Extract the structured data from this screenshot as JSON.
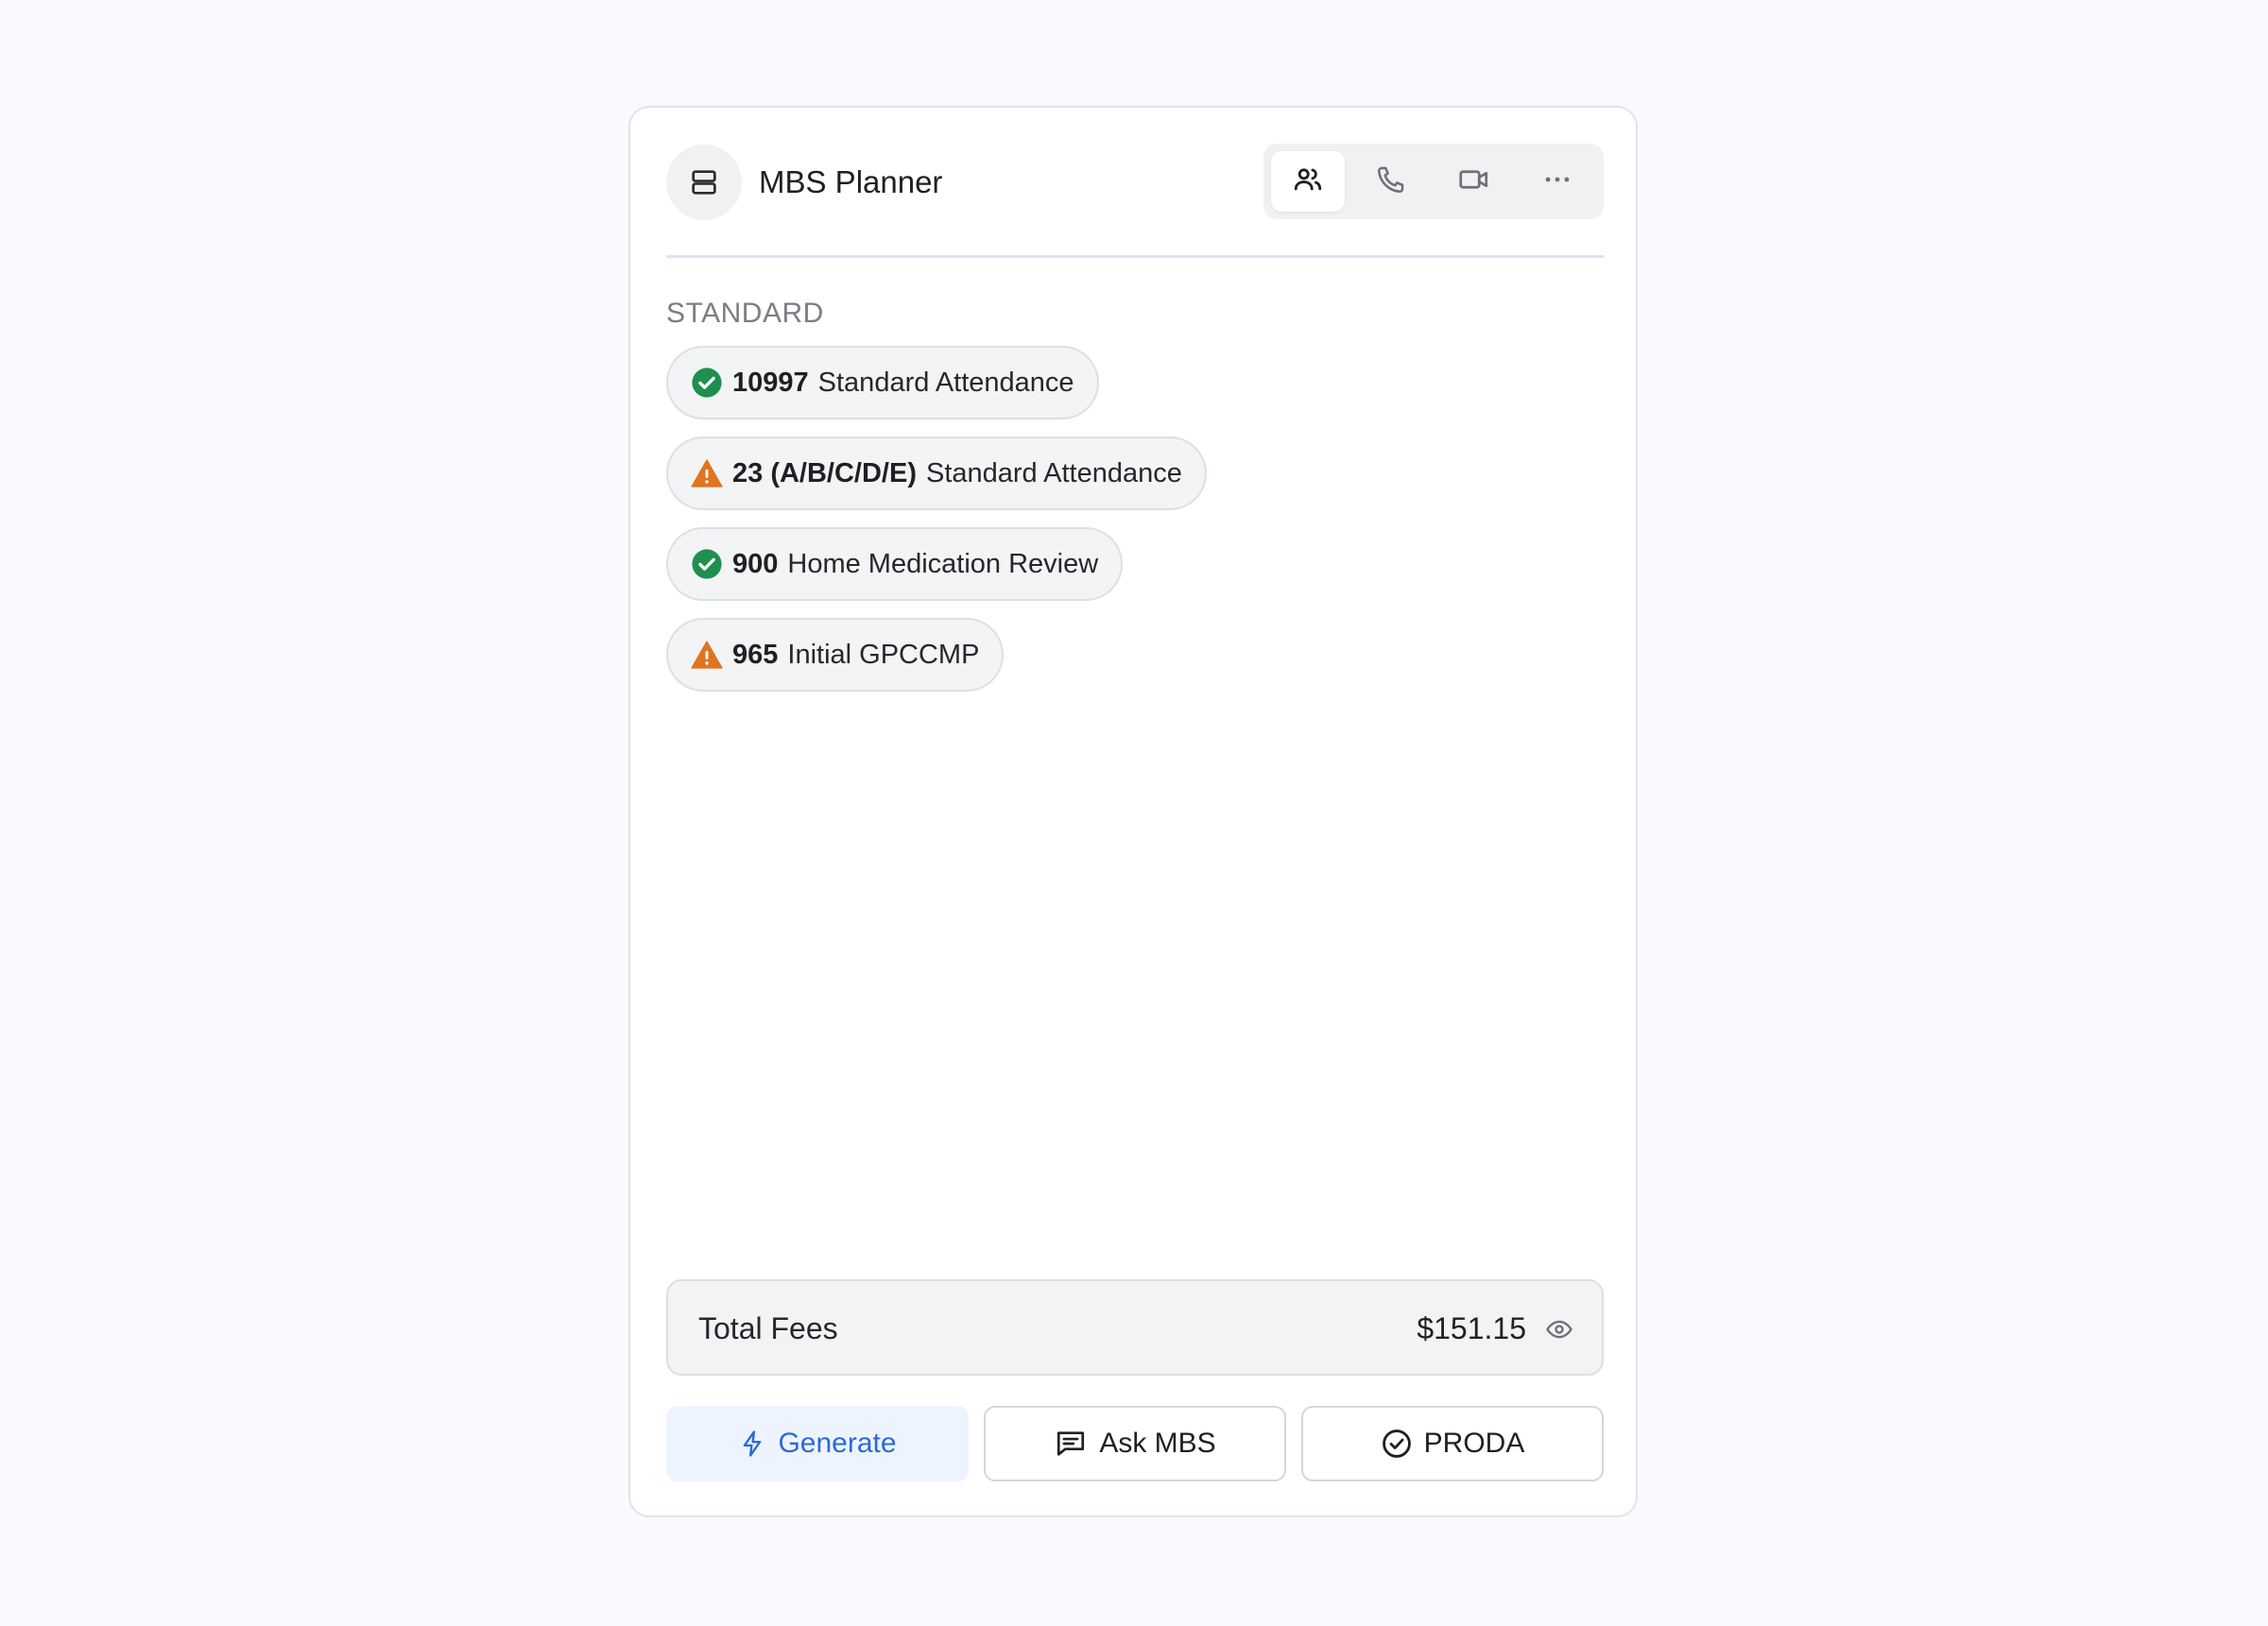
{
  "header": {
    "app_icon": "server-stack-icon",
    "title": "MBS Planner",
    "modes": [
      {
        "icon": "users-icon",
        "active": true
      },
      {
        "icon": "phone-icon",
        "active": false
      },
      {
        "icon": "video-camera-icon",
        "active": false
      },
      {
        "icon": "more-horizontal-icon",
        "active": false
      }
    ]
  },
  "section": {
    "label": "STANDARD",
    "items": [
      {
        "status": "ok",
        "status_icon": "check-circle-icon",
        "code": "10997",
        "description": "Standard Attendance"
      },
      {
        "status": "warning",
        "status_icon": "warning-triangle-icon",
        "code": "23 (A/B/C/D/E)",
        "description": "Standard Attendance"
      },
      {
        "status": "ok",
        "status_icon": "check-circle-icon",
        "code": "900",
        "description": "Home Medication Review"
      },
      {
        "status": "warning",
        "status_icon": "warning-triangle-icon",
        "code": "965",
        "description": "Initial GPCCMP"
      }
    ]
  },
  "total": {
    "label": "Total Fees",
    "value": "$151.15",
    "toggle_icon": "eye-icon"
  },
  "actions": {
    "generate": {
      "label": "Generate",
      "icon": "lightning-bolt-icon"
    },
    "ask": {
      "label": "Ask MBS",
      "icon": "chat-icon"
    },
    "proda": {
      "label": "PRODA",
      "icon": "check-circle-outline-icon"
    }
  },
  "colors": {
    "ok": "#1e8f4e",
    "warning": "#e0741f",
    "accent": "#2c6ad6",
    "accent_bg": "#eef4ff"
  }
}
